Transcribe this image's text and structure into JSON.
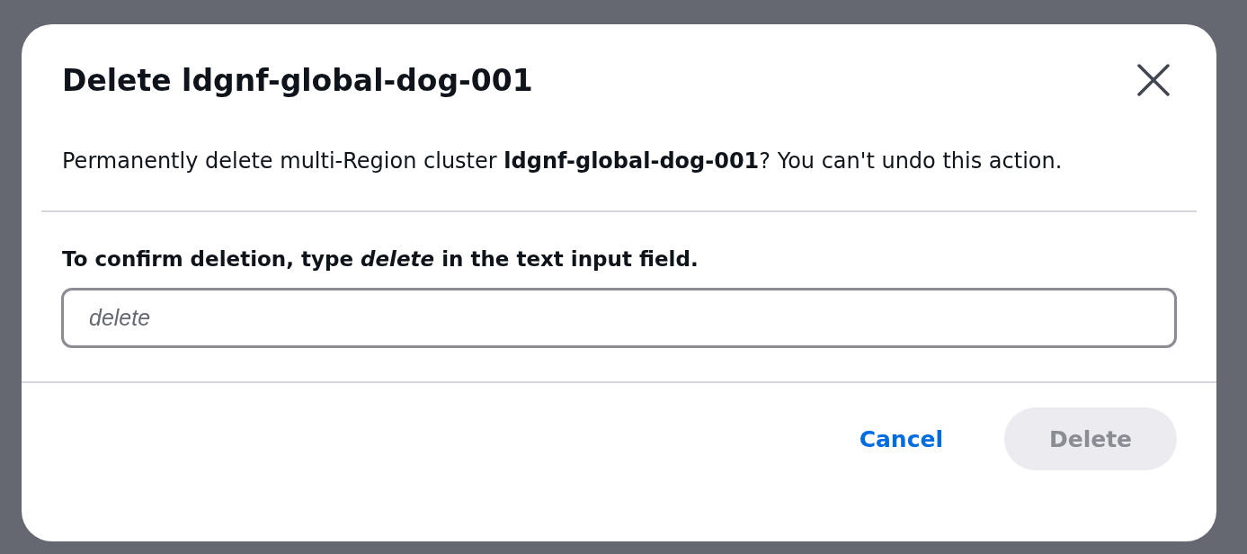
{
  "dialog": {
    "title": "Delete ldgnf-global-dog-001",
    "message": "Permanently delete multi-Region cluster **ldgnf-global-dog-001**? You can't undo this action.",
    "confirm_label": "To confirm deletion, type *delete* in the text input field.",
    "input": {
      "placeholder": "delete"
    },
    "buttons": [
      {
        "kind": "link",
        "label": "Cancel",
        "disabled": false
      },
      {
        "kind": "primary",
        "label": "Delete",
        "disabled": true
      }
    ]
  }
}
